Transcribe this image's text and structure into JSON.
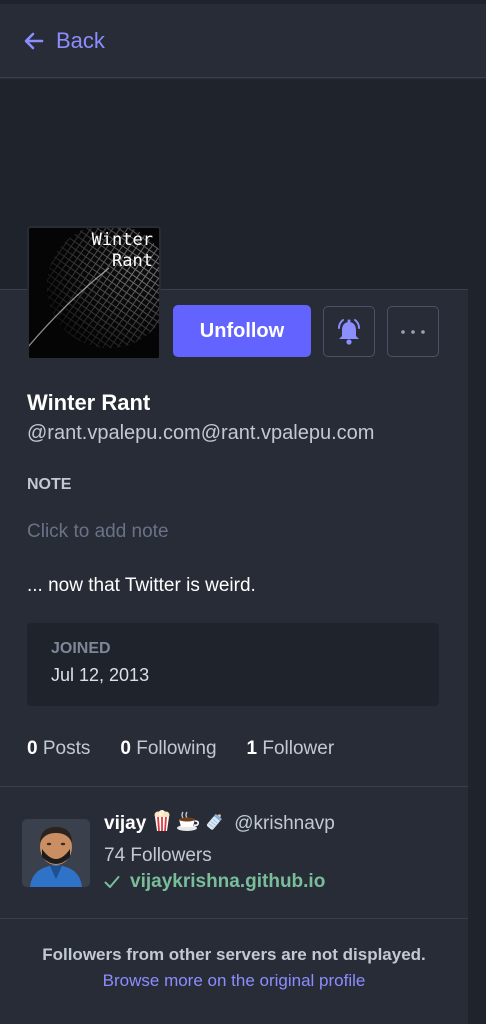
{
  "header": {
    "back_label": "Back"
  },
  "profile": {
    "avatar_text": "Winter\nRant",
    "unfollow_label": "Unfollow",
    "display_name": "Winter Rant",
    "acct": "@rant.vpalepu.com@rant.vpalepu.com",
    "note_label": "NOTE",
    "note_placeholder": "Click to add note",
    "bio": "... now that Twitter is weird.",
    "joined_label": "JOINED",
    "joined_date": "Jul 12, 2013",
    "counts": {
      "posts_num": "0",
      "posts_label": "Posts",
      "following_num": "0",
      "following_label": "Following",
      "followers_num": "1",
      "followers_label": "Follower"
    }
  },
  "follower": {
    "name": "vijay",
    "emojis": [
      "popcorn",
      "coffee",
      "baby-bottle"
    ],
    "handle": "@krishnavp",
    "followers": "74 Followers",
    "verified_domain": "vijaykrishna.github.io"
  },
  "footer": {
    "message": "Followers from other servers are not displayed.",
    "link": "Browse more on the original profile"
  },
  "colors": {
    "background": "#282c37",
    "banner": "#1f232b",
    "accent": "#6364ff",
    "link": "#8c8dff",
    "verified": "#79bd9a"
  }
}
